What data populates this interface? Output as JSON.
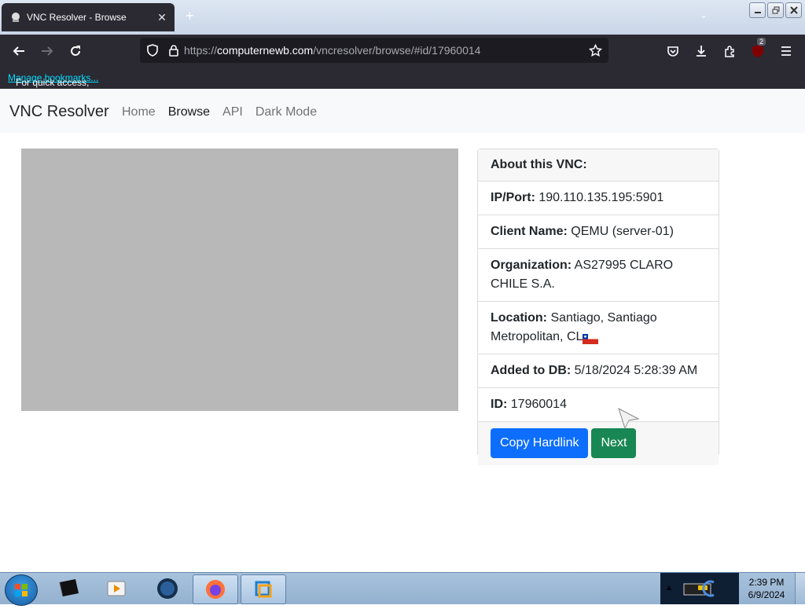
{
  "browser": {
    "tab_title": "VNC Resolver - Browse",
    "url_prefix": "https://",
    "url_host": "computernewb.com",
    "url_path": "/vncresolver/browse/#id/17960014",
    "bookmarks_text": "For quick access, place your bookmarks here on the bookmarks toolbar.",
    "bookmarks_link": "Manage bookmarks...",
    "extension_badge": "2"
  },
  "app": {
    "brand": "VNC Resolver",
    "nav": [
      "Home",
      "Browse",
      "API",
      "Dark Mode"
    ]
  },
  "card": {
    "header": "About this VNC:",
    "ip_label": "IP/Port:",
    "ip_value": "190.110.135.195:5901",
    "client_label": "Client Name:",
    "client_value": "QEMU (server-01)",
    "org_label": "Organization:",
    "org_value": "AS27995 CLARO CHILE S.A.",
    "location_label": "Location:",
    "location_value": "Santiago, Santiago Metropolitan, CL",
    "added_label": "Added to DB:",
    "added_value": "5/18/2024 5:28:39 AM",
    "id_label": "ID:",
    "id_value": "17960014",
    "copy_button": "Copy Hardlink",
    "next_button": "Next"
  },
  "taskbar": {
    "time": "2:39 PM",
    "date": "6/9/2024"
  },
  "colors": {
    "primary": "#0d6efd",
    "success": "#198754",
    "browser_dark": "#2b2a33"
  }
}
